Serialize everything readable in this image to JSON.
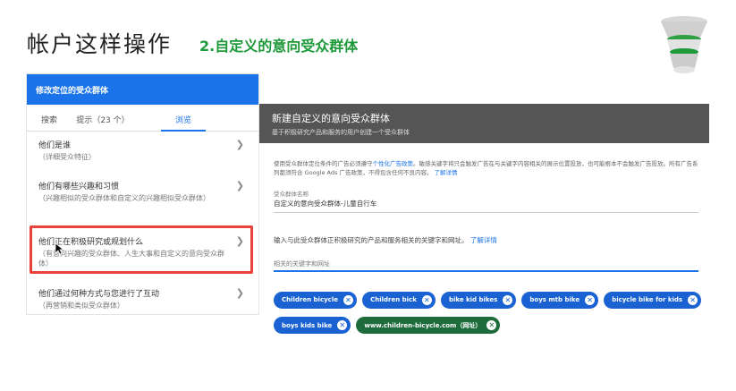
{
  "slide": {
    "title": "帐户这样操作",
    "subtitle": "2.自定义的意向受众群体"
  },
  "colors": {
    "accent": "#1a73e8",
    "brand_green": "#1f9a3a",
    "highlight": "#e8423a"
  },
  "left_panel": {
    "header": "修改定位的受众群体",
    "tabs": {
      "search": "搜索",
      "hints": "提示（23 个）",
      "browse": "浏览"
    },
    "items": [
      {
        "label": "他们是谁",
        "sub": "（详细受众特征）"
      },
      {
        "label": "他们有哪些兴趣和习惯",
        "sub": "（兴趣相似的受众群体和自定义的兴趣相似受众群体）"
      },
      {
        "label": "他们正在积极研究或规划什么",
        "sub": "（有意向兴趣的受众群体、人生大事和自定义的意向受众群体）"
      },
      {
        "label": "他们通过何种方式与您进行了互动",
        "sub": "（再营销和类似受众群体）"
      }
    ]
  },
  "right_panel": {
    "title": "新建自定义的意向受众群体",
    "subtitle": "基于积极研究产品和服务的用户创建一个受众群体",
    "notice_part1": "使用受众群体定位条件的广告必须遵守",
    "notice_link1": "个性化广告政策",
    "notice_part2": "。敏感关键字将只会触发广告在与关键字内容相关的展示位置投放，也可能根本不会触发广告投放。所有广告系列都须符合 Google Ads 广告政策，不得包含任何不良内容。",
    "notice_link2": "了解详情",
    "name_label": "受众群体名称",
    "name_value": "自定义的意向受众群体-儿童自行车",
    "keyword_prompt": "输入与此受众群体正积极研究的产品和服务相关的关键字和网址。",
    "keyword_link": "了解详情",
    "keyword_label": "相关的关键字和网址",
    "chips": [
      {
        "text": "Children bicycle",
        "type": "blue"
      },
      {
        "text": "Children bick",
        "type": "blue"
      },
      {
        "text": "bike kid bikes",
        "type": "blue"
      },
      {
        "text": "boys mtb bike",
        "type": "blue"
      },
      {
        "text": "bicycle bike for kids",
        "type": "blue"
      },
      {
        "text": "boys kids bike",
        "type": "blue"
      },
      {
        "text": "www.children-bicycle.com（网址）",
        "type": "green"
      }
    ]
  },
  "icons": {
    "chevron": "chevron-right-icon",
    "chip_remove": "close-icon",
    "funnel": "funnel-icon",
    "cursor": "mouse-cursor-icon"
  }
}
